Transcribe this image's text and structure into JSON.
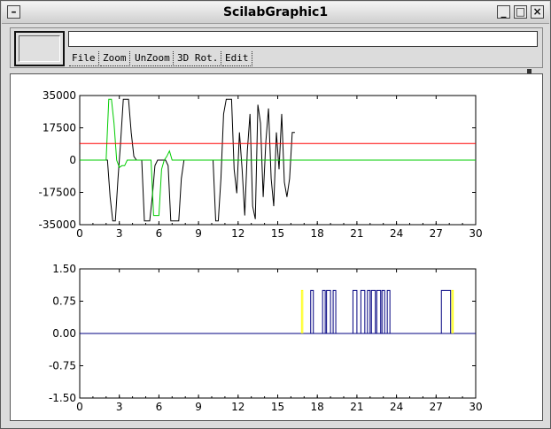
{
  "window": {
    "title": "ScilabGraphic1"
  },
  "infobar": {
    "text": ""
  },
  "menu": [
    "File",
    "Zoom",
    "UnZoom",
    "3D Rot.",
    "Edit"
  ],
  "colors": {
    "black": "#000000",
    "green": "#00cc00",
    "red": "#ff0000",
    "blue": "#000080",
    "yellow": "#ffff00"
  },
  "chart_data": [
    {
      "type": "line",
      "xlim": [
        0,
        30
      ],
      "ylim": [
        -35000,
        35000
      ],
      "xticks": [
        "0",
        "3",
        "6",
        "9",
        "12",
        "15",
        "18",
        "21",
        "24",
        "27",
        "30"
      ],
      "yticks": [
        "35000",
        "17500",
        "0",
        "-17500",
        "-35000"
      ],
      "series": [
        {
          "color": "black",
          "x": [
            0,
            2.1,
            2.3,
            2.5,
            2.7,
            2.9,
            3.1,
            3.3,
            3.5,
            3.7,
            3.9,
            4.1,
            4.3,
            4.5,
            4.7,
            4.9,
            5.1,
            5.3,
            5.5,
            5.7,
            5.9,
            6.1,
            6.3,
            6.5,
            6.7,
            6.9,
            7.1,
            7.3,
            7.5,
            7.7,
            7.9,
            8.1,
            8.3,
            8.5,
            8.7,
            8.9,
            9.1,
            9.3,
            9.5,
            9.7,
            9.9,
            10.1,
            10.3,
            10.5,
            10.7,
            10.9,
            11.1,
            11.3,
            11.5,
            11.7,
            11.9,
            12.1,
            12.3,
            12.5,
            12.7,
            12.9,
            13.1,
            13.3,
            13.5,
            13.7,
            13.9,
            14.1,
            14.3,
            14.5,
            14.7,
            14.9,
            15.1,
            15.3,
            15.5,
            15.7,
            15.9,
            16.1,
            16.3
          ],
          "y": [
            0,
            0,
            -20000,
            -33000,
            -33000,
            -10000,
            10000,
            33000,
            33000,
            33000,
            15000,
            2000,
            0,
            0,
            0,
            -33000,
            -33000,
            -33000,
            -20000,
            -3000,
            0,
            0,
            0,
            0,
            -3000,
            -33000,
            -33000,
            -33000,
            -33000,
            -10000,
            0,
            0,
            0,
            0,
            0,
            0,
            0,
            0,
            0,
            0,
            0,
            0,
            -33000,
            -33000,
            -10000,
            25000,
            33000,
            33000,
            33000,
            -5000,
            -18000,
            15000,
            -5000,
            -30000,
            5000,
            25000,
            -25000,
            -32000,
            30000,
            20000,
            -20000,
            10000,
            28000,
            -10000,
            -25000,
            15000,
            -5000,
            25000,
            -12000,
            -20000,
            -10000,
            15000,
            15000
          ]
        },
        {
          "color": "green",
          "x": [
            0,
            2.0,
            2.2,
            2.4,
            2.6,
            2.8,
            3.0,
            3.2,
            3.4,
            3.6,
            3.8,
            4.0,
            4.2,
            4.4,
            4.6,
            4.8,
            5.0,
            5.2,
            5.4,
            5.6,
            5.8,
            6.0,
            6.2,
            6.4,
            6.6,
            6.8,
            7.0,
            7.2,
            7.4,
            7.6,
            7.8,
            8.0,
            8.2,
            8.4,
            8.6,
            8.8,
            9.0,
            9.2,
            9.4,
            9.6,
            9.8,
            10.0,
            10.2,
            10.4,
            10.6,
            10.8,
            11.0,
            11.2,
            11.4,
            11.6,
            11.8,
            12.0,
            12.2,
            12.4,
            12.6,
            12.8,
            13.0,
            13.2,
            13.4,
            13.6,
            13.8,
            14.0,
            14.2,
            14.4,
            14.6,
            14.8,
            15.0,
            15.2,
            15.4,
            15.6,
            15.8,
            16.0,
            16.2,
            30
          ],
          "y": [
            0,
            0,
            33000,
            33000,
            20000,
            0,
            -4000,
            -3000,
            -3000,
            0,
            0,
            0,
            0,
            0,
            0,
            0,
            0,
            0,
            0,
            -30000,
            -30000,
            -30000,
            -5000,
            0,
            2000,
            5000,
            0,
            0,
            0,
            0,
            0,
            0,
            0,
            0,
            0,
            0,
            0,
            0,
            0,
            0,
            0,
            0,
            0,
            0,
            0,
            0,
            0,
            0,
            0,
            0,
            0,
            0,
            0,
            0,
            0,
            0,
            0,
            0,
            0,
            0,
            0,
            0,
            0,
            0,
            0,
            0,
            0,
            0,
            0,
            0,
            0,
            0,
            0,
            0
          ]
        },
        {
          "color": "red",
          "x": [
            0,
            30
          ],
          "y": [
            9000,
            9000
          ]
        }
      ]
    },
    {
      "type": "line",
      "xlim": [
        0,
        30
      ],
      "ylim": [
        -1.5,
        1.5
      ],
      "xticks": [
        "0",
        "3",
        "6",
        "9",
        "12",
        "15",
        "18",
        "21",
        "24",
        "27",
        "30"
      ],
      "yticks": [
        "1.50",
        "0.75",
        "0.00",
        "-0.75",
        "-1.50"
      ],
      "series": [
        {
          "color": "blue",
          "x": [
            0,
            30
          ],
          "y": [
            0,
            0
          ]
        }
      ],
      "pulses": [
        {
          "color": "yellow",
          "from": 16.8,
          "to": 16.9
        },
        {
          "color": "blue",
          "from": 17.5,
          "to": 17.7
        },
        {
          "color": "blue",
          "from": 18.4,
          "to": 18.6
        },
        {
          "color": "blue",
          "from": 18.7,
          "to": 19.0
        },
        {
          "color": "blue",
          "from": 19.2,
          "to": 19.4
        },
        {
          "color": "blue",
          "from": 20.7,
          "to": 21.0
        },
        {
          "color": "blue",
          "from": 21.3,
          "to": 21.6
        },
        {
          "color": "blue",
          "from": 21.8,
          "to": 22.0
        },
        {
          "color": "blue",
          "from": 22.1,
          "to": 22.4
        },
        {
          "color": "blue",
          "from": 22.5,
          "to": 22.8
        },
        {
          "color": "blue",
          "from": 22.9,
          "to": 23.1
        },
        {
          "color": "blue",
          "from": 23.3,
          "to": 23.5
        },
        {
          "color": "blue",
          "from": 27.4,
          "to": 28.1
        },
        {
          "color": "yellow",
          "from": 28.2,
          "to": 28.3
        }
      ]
    }
  ]
}
